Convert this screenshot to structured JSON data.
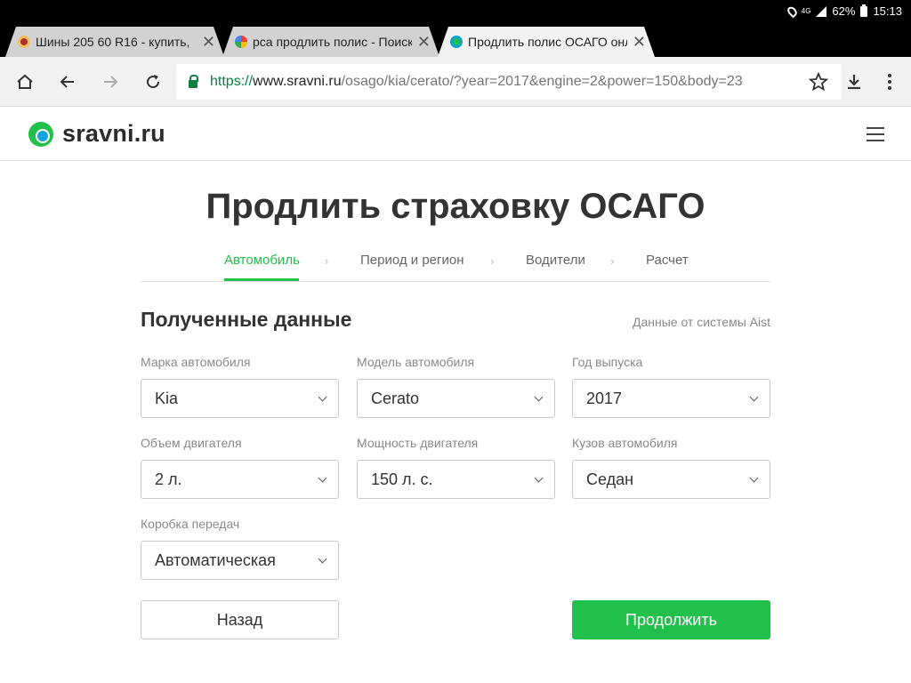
{
  "status_bar": {
    "battery": "62%",
    "time": "15:13",
    "network": "4G"
  },
  "tabs": [
    {
      "title": "Шины 205 60 R16 - купить, ",
      "close": "✕"
    },
    {
      "title": "рса продлить полис - Поиск",
      "close": "✕"
    },
    {
      "title": "Продлить полис ОСАГО онл",
      "close": "✕"
    }
  ],
  "url": {
    "scheme": "https://",
    "host": "www.sravni.ru",
    "path": "/osago/kia/cerato/?year=2017&engine=2&power=150&body=23"
  },
  "site": {
    "logo_text": "sravni.ru"
  },
  "page": {
    "title": "Продлить страховку ОСАГО",
    "steps": [
      "Автомобиль",
      "Период и регион",
      "Водители",
      "Расчет"
    ],
    "step_separator": "›",
    "section_title": "Полученные данные",
    "source_note": "Данные от системы Aist"
  },
  "fields": {
    "make": {
      "label": "Марка автомобиля",
      "value": "Kia"
    },
    "model": {
      "label": "Модель автомобиля",
      "value": "Cerato"
    },
    "year": {
      "label": "Год выпуска",
      "value": "2017"
    },
    "engine": {
      "label": "Объем двигателя",
      "value": "2 л."
    },
    "power": {
      "label": "Мощность двигателя",
      "value": "150 л. с."
    },
    "body": {
      "label": "Кузов автомобиля",
      "value": "Седан"
    },
    "gearbox": {
      "label": "Коробка передач",
      "value": "Автоматическая"
    }
  },
  "buttons": {
    "back": "Назад",
    "next": "Продолжить"
  },
  "colors": {
    "accent": "#21c04b",
    "secure": "#0b8043"
  },
  "icons": [
    "home-icon",
    "back-arrow-icon",
    "forward-arrow-icon",
    "reload-icon",
    "lock-icon",
    "star-icon",
    "download-icon",
    "menu-dots-icon",
    "hamburger-menu-icon",
    "chevron-down-icon"
  ]
}
